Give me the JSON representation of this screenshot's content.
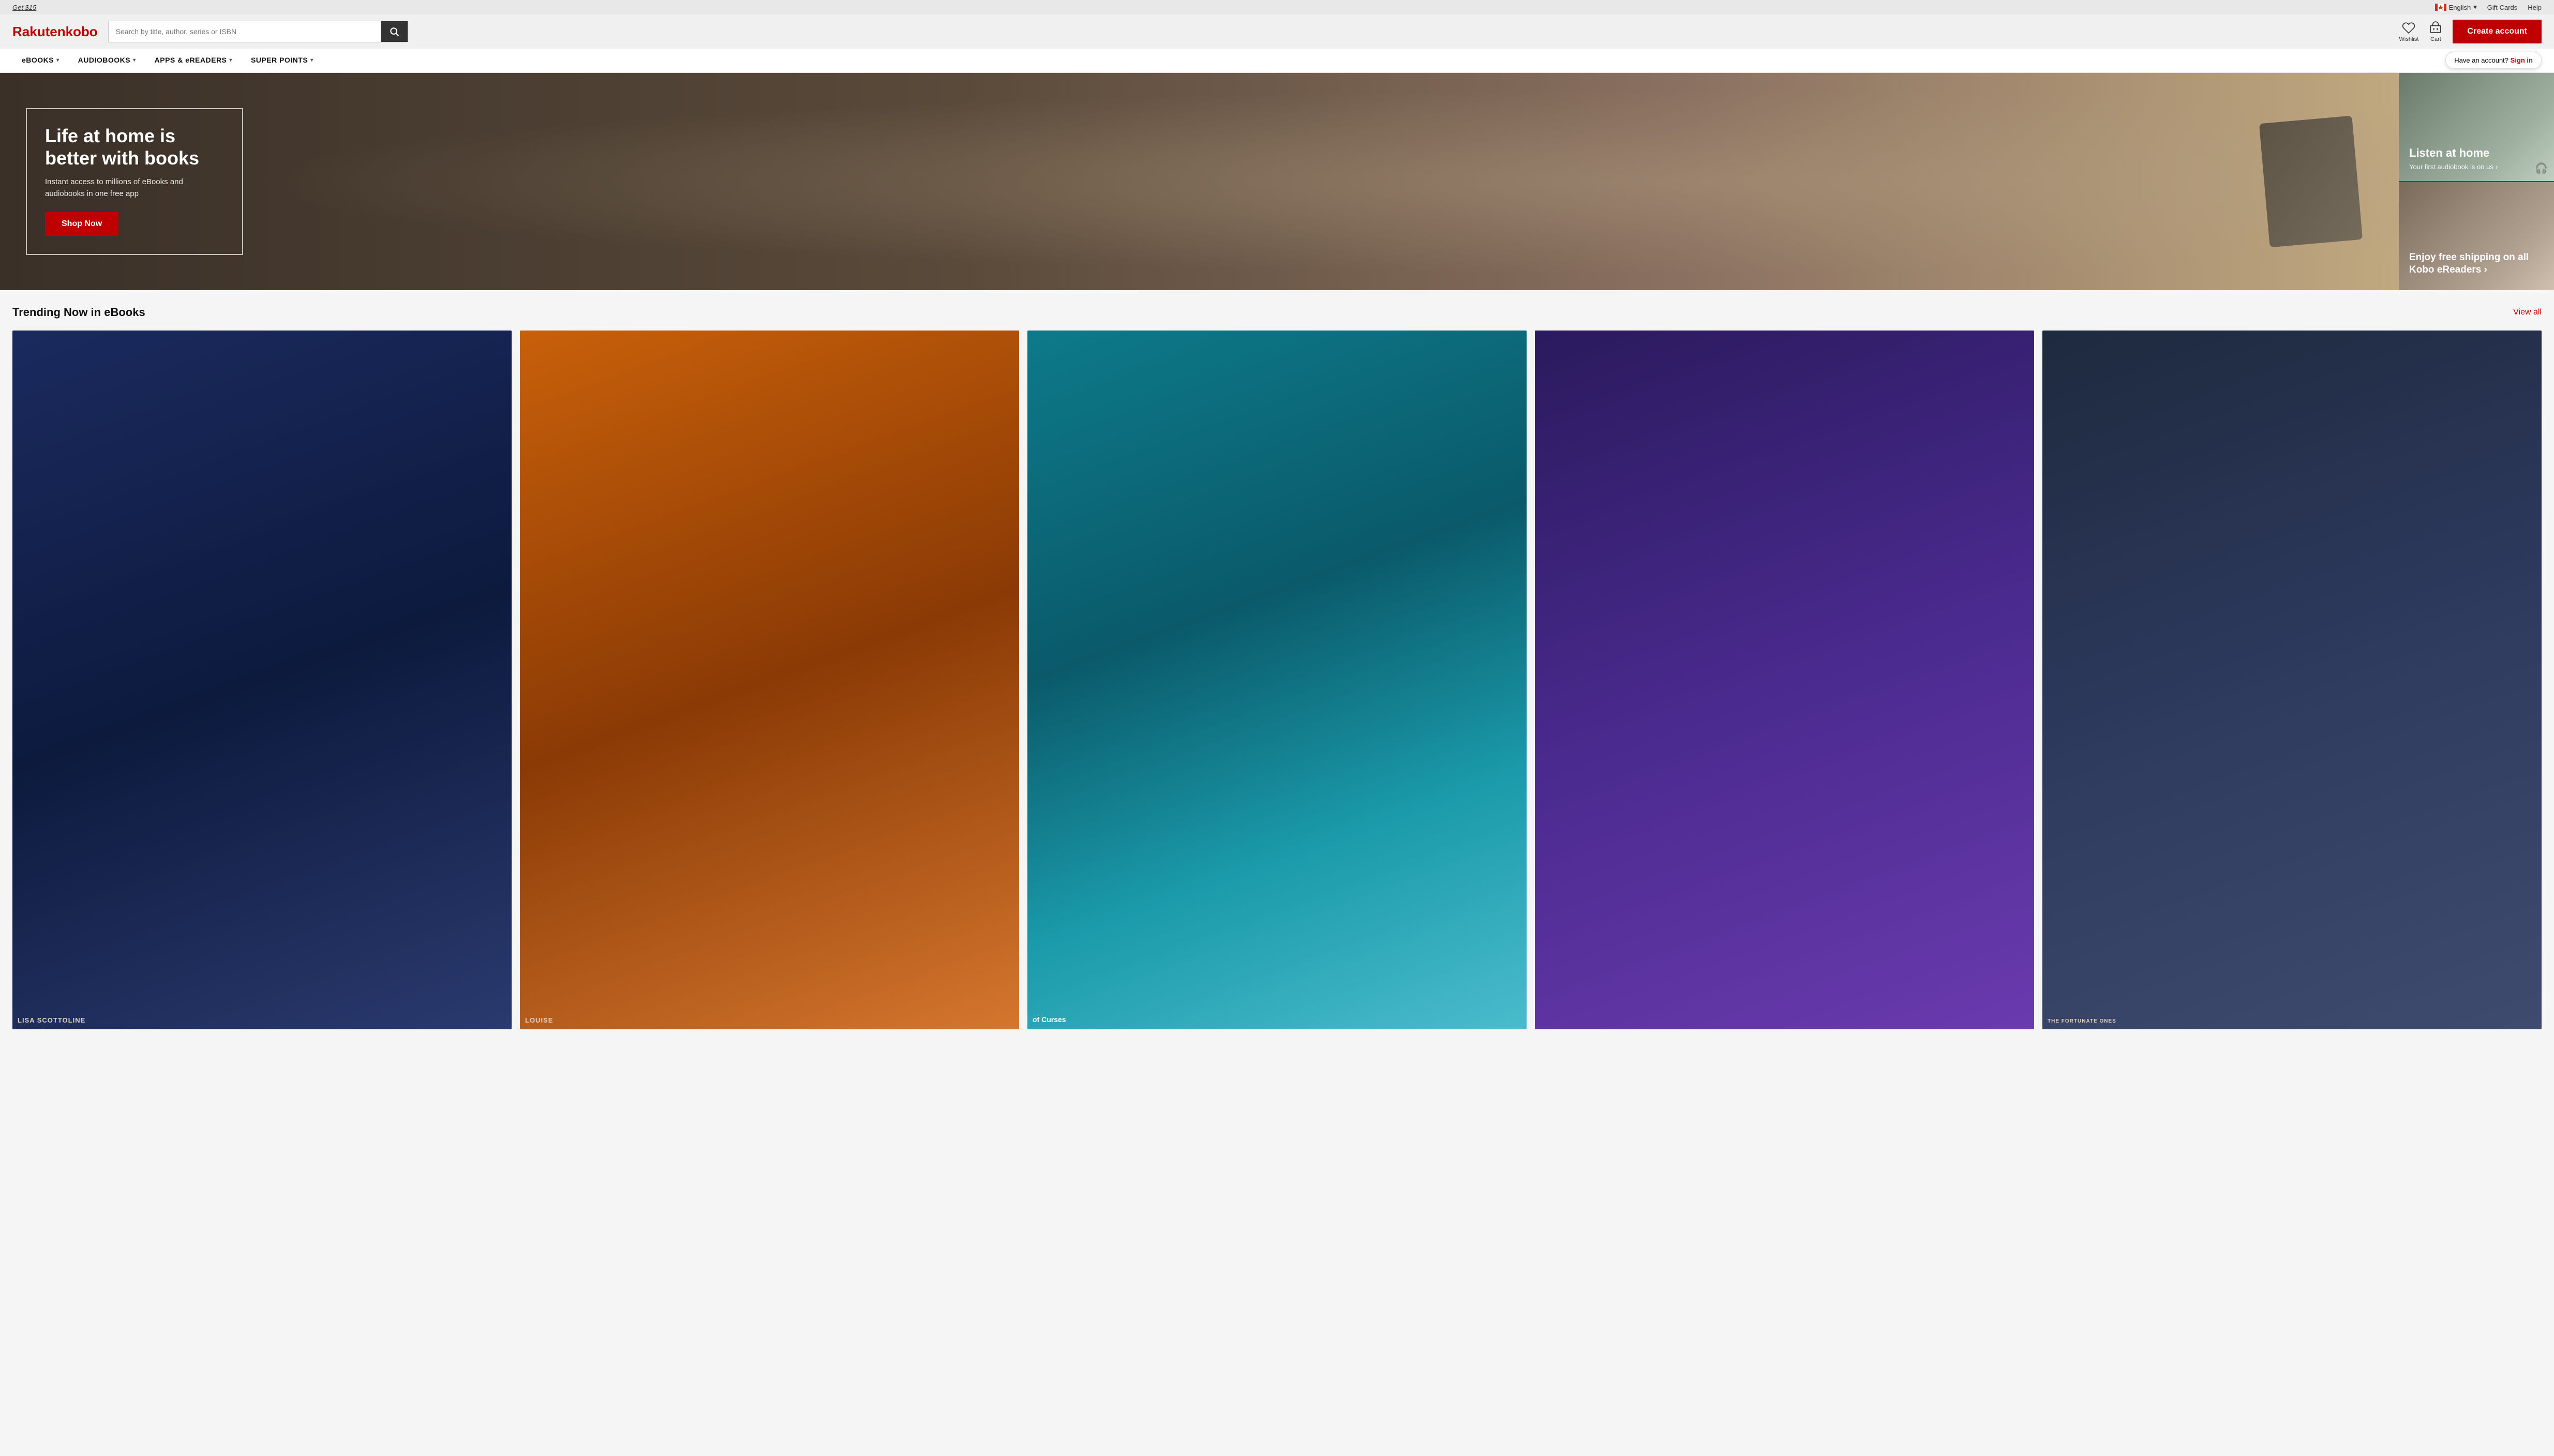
{
  "topbar": {
    "promo_text": "Get $15",
    "language": "English",
    "gift_cards": "Gift Cards",
    "help": "Help"
  },
  "header": {
    "logo_rakuten": "Rakuten",
    "logo_kobo": " kobo",
    "search_placeholder": "Search by title, author, series or ISBN",
    "wishlist_label": "Wishlist",
    "cart_label": "Cart",
    "create_account": "Create account",
    "have_account": "Have an account?",
    "sign_in": "Sign in"
  },
  "nav": {
    "items": [
      {
        "label": "eBOOKS",
        "has_dropdown": true
      },
      {
        "label": "AUDIOBOOKS",
        "has_dropdown": true
      },
      {
        "label": "APPS & eREADERS",
        "has_dropdown": true
      },
      {
        "label": "SUPER POINTS",
        "has_dropdown": true
      }
    ]
  },
  "hero": {
    "main": {
      "title": "Life at home is better with books",
      "subtitle": "Instant access to millions of eBooks and audiobooks in one free app",
      "cta": "Shop Now"
    },
    "side_top": {
      "title": "Listen at home",
      "subtitle": "Your first audiobook is on us"
    },
    "side_bottom": {
      "title": "Enjoy free shipping on all Kobo eReaders",
      "arrow": "›"
    }
  },
  "trending": {
    "section_title": "Trending Now in eBooks",
    "view_all": "View all",
    "books": [
      {
        "author": "LISA SCOTTOLINE",
        "title": "",
        "cover_class": "book-cover-1"
      },
      {
        "author": "LOUISE",
        "title": "",
        "cover_class": "book-cover-2"
      },
      {
        "author": "",
        "title": "of Curses",
        "cover_class": "book-cover-3"
      },
      {
        "author": "",
        "title": "",
        "cover_class": "book-cover-4"
      },
      {
        "author": "the FORTUNATE ONES",
        "title": "",
        "cover_class": "book-cover-5"
      }
    ]
  }
}
